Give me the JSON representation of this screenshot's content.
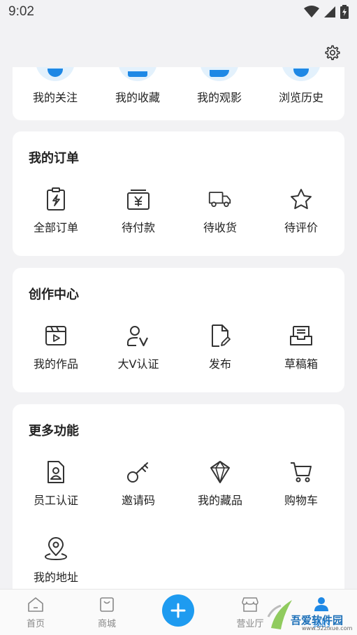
{
  "status_bar": {
    "time": "9:02"
  },
  "top_shortcuts": [
    {
      "label": "我的关注",
      "icon": "follow-icon"
    },
    {
      "label": "我的收藏",
      "icon": "favorites-icon"
    },
    {
      "label": "我的观影",
      "icon": "movie-icon"
    },
    {
      "label": "浏览历史",
      "icon": "history-icon"
    }
  ],
  "orders": {
    "title": "我的订单",
    "items": [
      {
        "label": "全部订单",
        "icon": "clipboard-bolt-icon"
      },
      {
        "label": "待付款",
        "icon": "yen-wallet-icon"
      },
      {
        "label": "待收货",
        "icon": "truck-icon"
      },
      {
        "label": "待评价",
        "icon": "star-icon"
      }
    ]
  },
  "creation": {
    "title": "创作中心",
    "items": [
      {
        "label": "我的作品",
        "icon": "video-clapper-icon"
      },
      {
        "label": "大V认证",
        "icon": "user-v-icon"
      },
      {
        "label": "发布",
        "icon": "file-edit-icon"
      },
      {
        "label": "草稿箱",
        "icon": "inbox-icon"
      }
    ]
  },
  "more": {
    "title": "更多功能",
    "items": [
      {
        "label": "员工认证",
        "icon": "badge-person-icon"
      },
      {
        "label": "邀请码",
        "icon": "key-icon"
      },
      {
        "label": "我的藏品",
        "icon": "diamond-icon"
      },
      {
        "label": "购物车",
        "icon": "cart-icon"
      },
      {
        "label": "我的地址",
        "icon": "location-pin-icon"
      }
    ]
  },
  "tabbar": {
    "tabs": [
      {
        "label": "首页",
        "icon": "home-icon"
      },
      {
        "label": "商城",
        "icon": "shopping-bag-icon"
      },
      {
        "label": "营业厅",
        "icon": "store-icon"
      },
      {
        "label": "我的",
        "icon": "profile-icon"
      }
    ]
  },
  "watermark": {
    "text": "吾爱软件园",
    "url": "www.52zixue.com"
  },
  "colors": {
    "accent": "#1e88e5",
    "background": "#f2f2f4",
    "card": "#ffffff"
  }
}
